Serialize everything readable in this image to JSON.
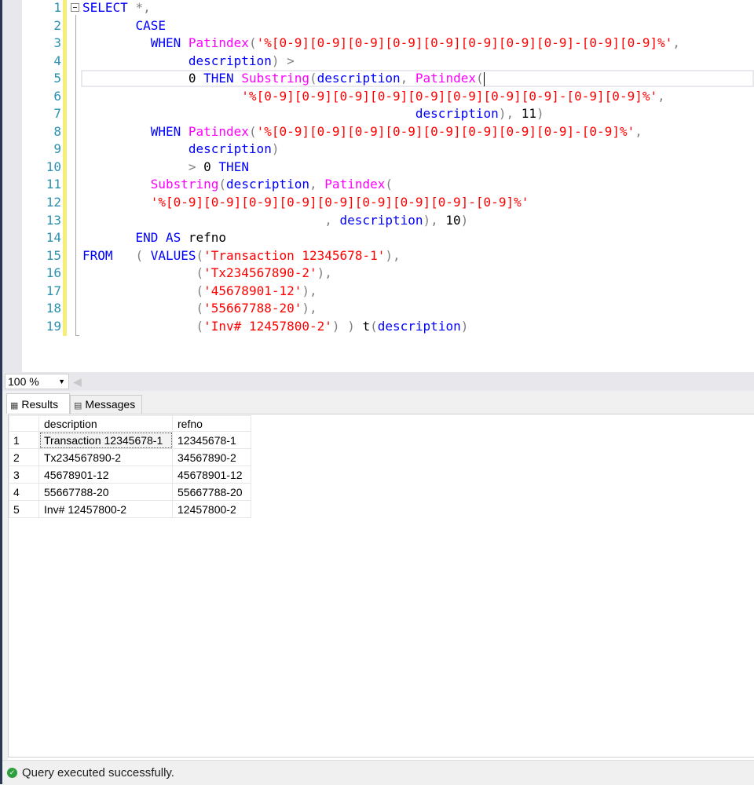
{
  "editor": {
    "line_numbers": [
      "1",
      "2",
      "3",
      "4",
      "5",
      "6",
      "7",
      "8",
      "9",
      "10",
      "11",
      "12",
      "13",
      "14",
      "15",
      "16",
      "17",
      "18",
      "19"
    ],
    "current_line": 5,
    "lines": [
      [
        [
          "k",
          "SELECT"
        ],
        [
          "w",
          " "
        ],
        [
          "o",
          "*,"
        ]
      ],
      [
        [
          "w",
          "       "
        ],
        [
          "k",
          "CASE"
        ]
      ],
      [
        [
          "w",
          "         "
        ],
        [
          "k",
          "WHEN"
        ],
        [
          "w",
          " "
        ],
        [
          "f",
          "Patindex"
        ],
        [
          "o",
          "("
        ],
        [
          "s",
          "'%[0-9][0-9][0-9][0-9][0-9][0-9][0-9][0-9]-[0-9][0-9]%'"
        ],
        [
          "o",
          ","
        ]
      ],
      [
        [
          "w",
          "              "
        ],
        [
          "i",
          "description"
        ],
        [
          "o",
          ")"
        ],
        [
          "w",
          " "
        ],
        [
          "o",
          ">"
        ]
      ],
      [
        [
          "w",
          "              "
        ],
        [
          "n",
          "0"
        ],
        [
          "w",
          " "
        ],
        [
          "k",
          "THEN"
        ],
        [
          "w",
          " "
        ],
        [
          "f",
          "Substring"
        ],
        [
          "o",
          "("
        ],
        [
          "i",
          "description"
        ],
        [
          "o",
          ","
        ],
        [
          "w",
          " "
        ],
        [
          "f",
          "Patindex"
        ],
        [
          "o",
          "("
        ]
      ],
      [
        [
          "w",
          "                     "
        ],
        [
          "s",
          "'%[0-9][0-9][0-9][0-9][0-9][0-9][0-9][0-9]-[0-9][0-9]%'"
        ],
        [
          "o",
          ","
        ]
      ],
      [
        [
          "w",
          "                                            "
        ],
        [
          "i",
          "description"
        ],
        [
          "o",
          "),"
        ],
        [
          "w",
          " "
        ],
        [
          "n",
          "11"
        ],
        [
          "o",
          ")"
        ]
      ],
      [
        [
          "w",
          "         "
        ],
        [
          "k",
          "WHEN"
        ],
        [
          "w",
          " "
        ],
        [
          "f",
          "Patindex"
        ],
        [
          "o",
          "("
        ],
        [
          "s",
          "'%[0-9][0-9][0-9][0-9][0-9][0-9][0-9][0-9]-[0-9]%'"
        ],
        [
          "o",
          ","
        ]
      ],
      [
        [
          "w",
          "              "
        ],
        [
          "i",
          "description"
        ],
        [
          "o",
          ")"
        ]
      ],
      [
        [
          "w",
          "              "
        ],
        [
          "o",
          ">"
        ],
        [
          "w",
          " "
        ],
        [
          "n",
          "0"
        ],
        [
          "w",
          " "
        ],
        [
          "k",
          "THEN"
        ]
      ],
      [
        [
          "w",
          "         "
        ],
        [
          "f",
          "Substring"
        ],
        [
          "o",
          "("
        ],
        [
          "i",
          "description"
        ],
        [
          "o",
          ","
        ],
        [
          "w",
          " "
        ],
        [
          "f",
          "Patindex"
        ],
        [
          "o",
          "("
        ]
      ],
      [
        [
          "w",
          "         "
        ],
        [
          "s",
          "'%[0-9][0-9][0-9][0-9][0-9][0-9][0-9][0-9]-[0-9]%'"
        ]
      ],
      [
        [
          "w",
          "                                "
        ],
        [
          "o",
          ","
        ],
        [
          "w",
          " "
        ],
        [
          "i",
          "description"
        ],
        [
          "o",
          "),"
        ],
        [
          "w",
          " "
        ],
        [
          "n",
          "10"
        ],
        [
          "o",
          ")"
        ]
      ],
      [
        [
          "w",
          "       "
        ],
        [
          "k",
          "END"
        ],
        [
          "w",
          " "
        ],
        [
          "k",
          "AS"
        ],
        [
          "w",
          " "
        ],
        [
          "n",
          "refno"
        ]
      ],
      [
        [
          "k",
          "FROM"
        ],
        [
          "w",
          "   "
        ],
        [
          "o",
          "("
        ],
        [
          "w",
          " "
        ],
        [
          "k",
          "VALUES"
        ],
        [
          "o",
          "("
        ],
        [
          "s",
          "'Transaction 12345678-1'"
        ],
        [
          "o",
          "),"
        ]
      ],
      [
        [
          "w",
          "               "
        ],
        [
          "o",
          "("
        ],
        [
          "s",
          "'Tx234567890-2'"
        ],
        [
          "o",
          "),"
        ]
      ],
      [
        [
          "w",
          "               "
        ],
        [
          "o",
          "("
        ],
        [
          "s",
          "'45678901-12'"
        ],
        [
          "o",
          "),"
        ]
      ],
      [
        [
          "w",
          "               "
        ],
        [
          "o",
          "("
        ],
        [
          "s",
          "'55667788-20'"
        ],
        [
          "o",
          "),"
        ]
      ],
      [
        [
          "w",
          "               "
        ],
        [
          "o",
          "("
        ],
        [
          "s",
          "'Inv# 12457800-2'"
        ],
        [
          "o",
          ")"
        ],
        [
          "w",
          " "
        ],
        [
          "o",
          ")"
        ],
        [
          "w",
          " "
        ],
        [
          "n",
          "t"
        ],
        [
          "o",
          "("
        ],
        [
          "i",
          "description"
        ],
        [
          "o",
          ")"
        ]
      ]
    ],
    "colors": {
      "keyword": "#0000ff",
      "function": "#ff00ff",
      "string": "#ff0000",
      "operator": "#808080",
      "line_number": "#2b91af"
    }
  },
  "zoom": {
    "value": "100 %"
  },
  "tabs": {
    "results": {
      "label": "Results",
      "icon": "grid-icon"
    },
    "messages": {
      "label": "Messages",
      "icon": "messages-icon"
    }
  },
  "grid": {
    "columns": [
      "description",
      "refno"
    ],
    "rows": [
      {
        "num": "1",
        "description": "Transaction 12345678-1",
        "refno": "12345678-1"
      },
      {
        "num": "2",
        "description": "Tx234567890-2",
        "refno": "34567890-2"
      },
      {
        "num": "3",
        "description": "45678901-12",
        "refno": "45678901-12"
      },
      {
        "num": "4",
        "description": "55667788-20",
        "refno": "55667788-20"
      },
      {
        "num": "5",
        "description": "Inv# 12457800-2",
        "refno": "12457800-2"
      }
    ]
  },
  "status": {
    "text": "Query executed successfully.",
    "icon": "check-circle-icon",
    "color": "#2e9e3e"
  }
}
